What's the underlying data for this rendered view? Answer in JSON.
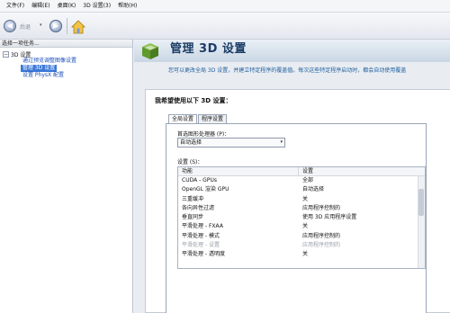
{
  "menu": [
    "文件(F)",
    "编辑(E)",
    "桌面(K)",
    "3D 设置(3)",
    "帮助(H)"
  ],
  "toolbar": {
    "back_label": "后退",
    "dropdown_glyph": "▾",
    "back_glyph": "◀",
    "forward_glyph": "▶"
  },
  "sidebar": {
    "header": "选择一项任务...",
    "root_toggle": "−",
    "root_label": "3D 设置",
    "items": [
      "通过预览调整图像设置",
      "管理 3D 设置",
      "设置 PhysX 配置"
    ]
  },
  "banner": {
    "title": "管理 3D 设置"
  },
  "description": "您可以更改全局 3D 设置，并建立特定程序的覆盖值。每次这些特定程序启动时，都会自动使用覆盖",
  "panel": {
    "title": "我希望使用以下 3D 设置：",
    "tabs": [
      "全局设置",
      "程序设置"
    ],
    "gpu_label": "首选图形处理器 (P)：",
    "gpu_value": "自动选择",
    "dropdown_glyph": "▾",
    "settings_label": "设置 (S)：",
    "table": {
      "headers": [
        "功能",
        "设置"
      ],
      "rows": [
        [
          "CUDA - GPUs",
          "全部"
        ],
        [
          "OpenGL 渲染 GPU",
          "自动选择"
        ],
        [
          "三重缓冲",
          "关"
        ],
        [
          "各向异性过滤",
          "应用程序控制的"
        ],
        [
          "垂直同步",
          "使用 3D 应用程序设置"
        ],
        [
          "平滑处理 - FXAA",
          "关"
        ],
        [
          "平滑处理 - 模式",
          "应用程序控制的"
        ],
        [
          "平滑处理 - 设置",
          "应用程序控制的"
        ],
        [
          "平滑处理 - 透明度",
          "关"
        ]
      ],
      "muted_rows": [
        7
      ]
    }
  }
}
